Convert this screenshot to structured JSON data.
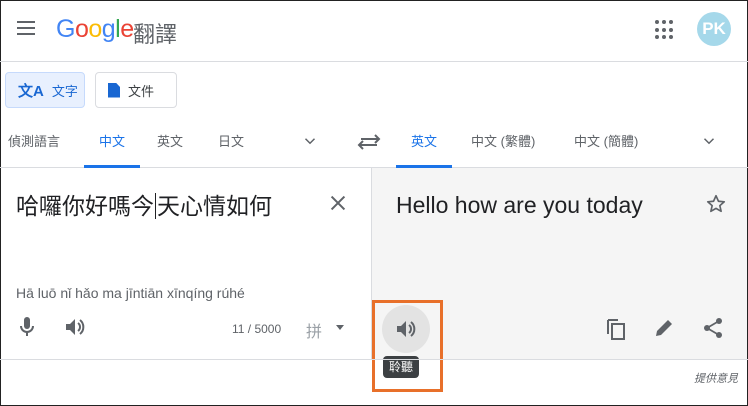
{
  "header": {
    "logo_text": "Google",
    "product_name": "翻譯",
    "avatar_initials": "PK"
  },
  "modes": {
    "text_label": "文字",
    "document_label": "文件",
    "text_icon_glyph": "文A"
  },
  "source_langs": [
    {
      "label": "偵測語言",
      "active": false
    },
    {
      "label": "中文",
      "active": true
    },
    {
      "label": "英文",
      "active": false
    },
    {
      "label": "日文",
      "active": false
    }
  ],
  "target_langs": [
    {
      "label": "英文",
      "active": true
    },
    {
      "label": "中文 (繁體)",
      "active": false
    },
    {
      "label": "中文 (簡體)",
      "active": false
    }
  ],
  "source": {
    "text_before_cursor": "哈囉你好嗎今",
    "text_after_cursor": "天心情如何",
    "romanization": "Hā luō nǐ hǎo ma jīntiān xīnqíng rúhé",
    "char_count": "11 / 5000",
    "ime_glyph": "拼"
  },
  "target": {
    "translation": "Hello how are you today",
    "listen_tooltip": "聆聽"
  },
  "footer": {
    "feedback_label": "提供意見"
  },
  "colors": {
    "accent": "#1a73e8",
    "highlight": "#e8702a",
    "avatar_bg": "#a5d8ea",
    "target_bg": "#f5f5f5"
  },
  "icons": [
    "menu-icon",
    "apps-icon",
    "translate-text-icon",
    "document-icon",
    "chevron-down-icon",
    "swap-icon",
    "close-icon",
    "mic-icon",
    "speaker-icon",
    "star-icon",
    "copy-icon",
    "edit-icon",
    "share-icon"
  ]
}
